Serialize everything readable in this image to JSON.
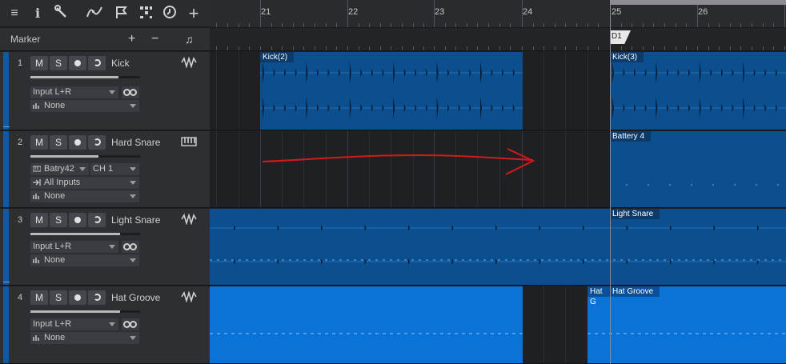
{
  "toolbar": {
    "icons": [
      "menu-icon",
      "info-icon",
      "wrench-icon",
      "curve-icon",
      "flag-icon",
      "quantize-icon",
      "clock-icon",
      "add-icon"
    ]
  },
  "marker": {
    "label": "Marker",
    "add": "+",
    "remove": "−",
    "note": "♫"
  },
  "ruler": {
    "bars": [
      "21",
      "22",
      "23",
      "24",
      "25",
      "26"
    ]
  },
  "marker_lane": {
    "marker_label": "D1"
  },
  "buttons": {
    "mute": "M",
    "solo": "S"
  },
  "tracks": [
    {
      "number": "1",
      "name": "Kick",
      "fader": 0.8,
      "input": "Input L+R",
      "output": "None"
    },
    {
      "number": "2",
      "name": "Hard Snare",
      "fader": 0.62,
      "instrument": "Batry42",
      "channel": "CH 1",
      "input": "All Inputs",
      "output": "None"
    },
    {
      "number": "3",
      "name": "Light Snare",
      "fader": 0.82,
      "input": "Input L+R",
      "output": "None"
    },
    {
      "number": "4",
      "name": "Hat Groove",
      "fader": 0.82,
      "input": "Input L+R",
      "output": "None"
    }
  ],
  "clips": {
    "kick_a": "Kick(2)",
    "kick_b": "Kick(3)",
    "battery": "Battery 4",
    "light_snare": "Light Snare",
    "hat_a": "Hat G",
    "hat_b": "Hat Groove"
  },
  "colors": {
    "clip_dark": "#0b4f8e",
    "clip_light": "#0a73d8",
    "annotation": "#d21a1a",
    "track_strip": "#0d5aa8"
  }
}
